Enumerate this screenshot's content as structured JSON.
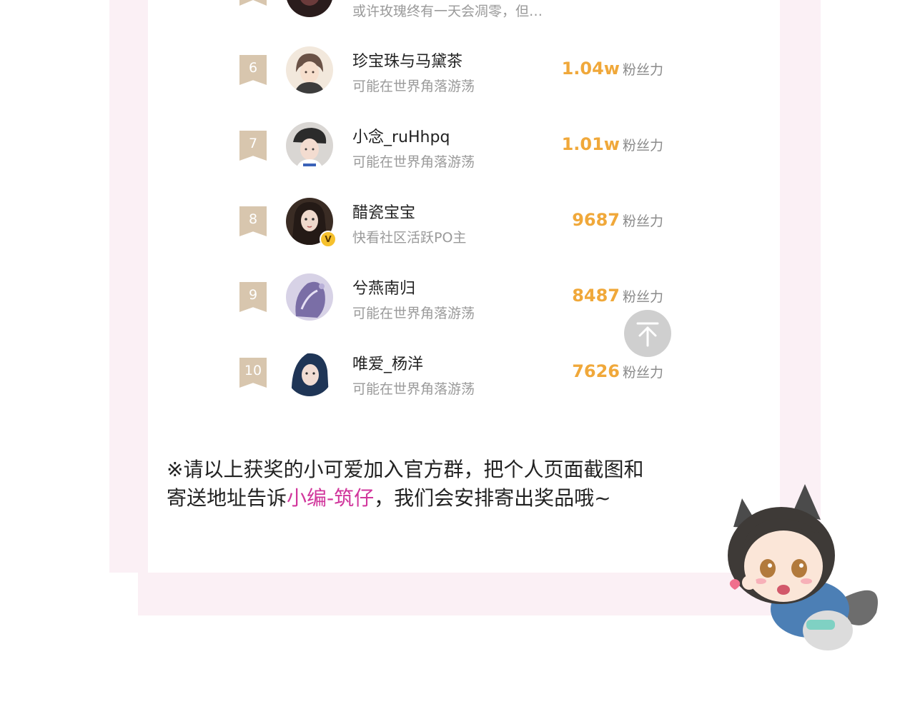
{
  "ranking": {
    "partial_top_row": {
      "subtitle": "或许玫瑰终有一天会凋零，但…"
    },
    "rows": [
      {
        "rank": "6",
        "name": "珍宝珠与马黛茶",
        "subtitle": "可能在世界角落游荡",
        "score": "1.04w",
        "unit": "粉丝力",
        "verified": false
      },
      {
        "rank": "7",
        "name": "小念_ruHhpq",
        "subtitle": "可能在世界角落游荡",
        "score": "1.01w",
        "unit": "粉丝力",
        "verified": false
      },
      {
        "rank": "8",
        "name": "醋瓷宝宝",
        "subtitle": "快看社区活跃PO主",
        "score": "9687",
        "unit": "粉丝力",
        "verified": true
      },
      {
        "rank": "9",
        "name": "兮燕南归",
        "subtitle": "可能在世界角落游荡",
        "score": "8487",
        "unit": "粉丝力",
        "verified": false
      },
      {
        "rank": "10",
        "name": "唯爱_杨洋",
        "subtitle": "可能在世界角落游荡",
        "score": "7626",
        "unit": "粉丝力",
        "verified": false
      }
    ],
    "verified_badge": "V"
  },
  "notice": {
    "line1": "※请以上获奖的小可爱加入官方群，把个人页面截图和",
    "line2_prefix": "寄送地址告诉",
    "line2_highlight": "小编-筑仔",
    "line2_suffix": "，我们会安排寄出奖品哦~"
  },
  "icons": {
    "scroll_top": "arrow-up-icon"
  },
  "colors": {
    "accent_score": "#f0a83a",
    "highlight": "#d1369c",
    "badge": "#d8c6ae",
    "frame": "#fbf0f5"
  }
}
